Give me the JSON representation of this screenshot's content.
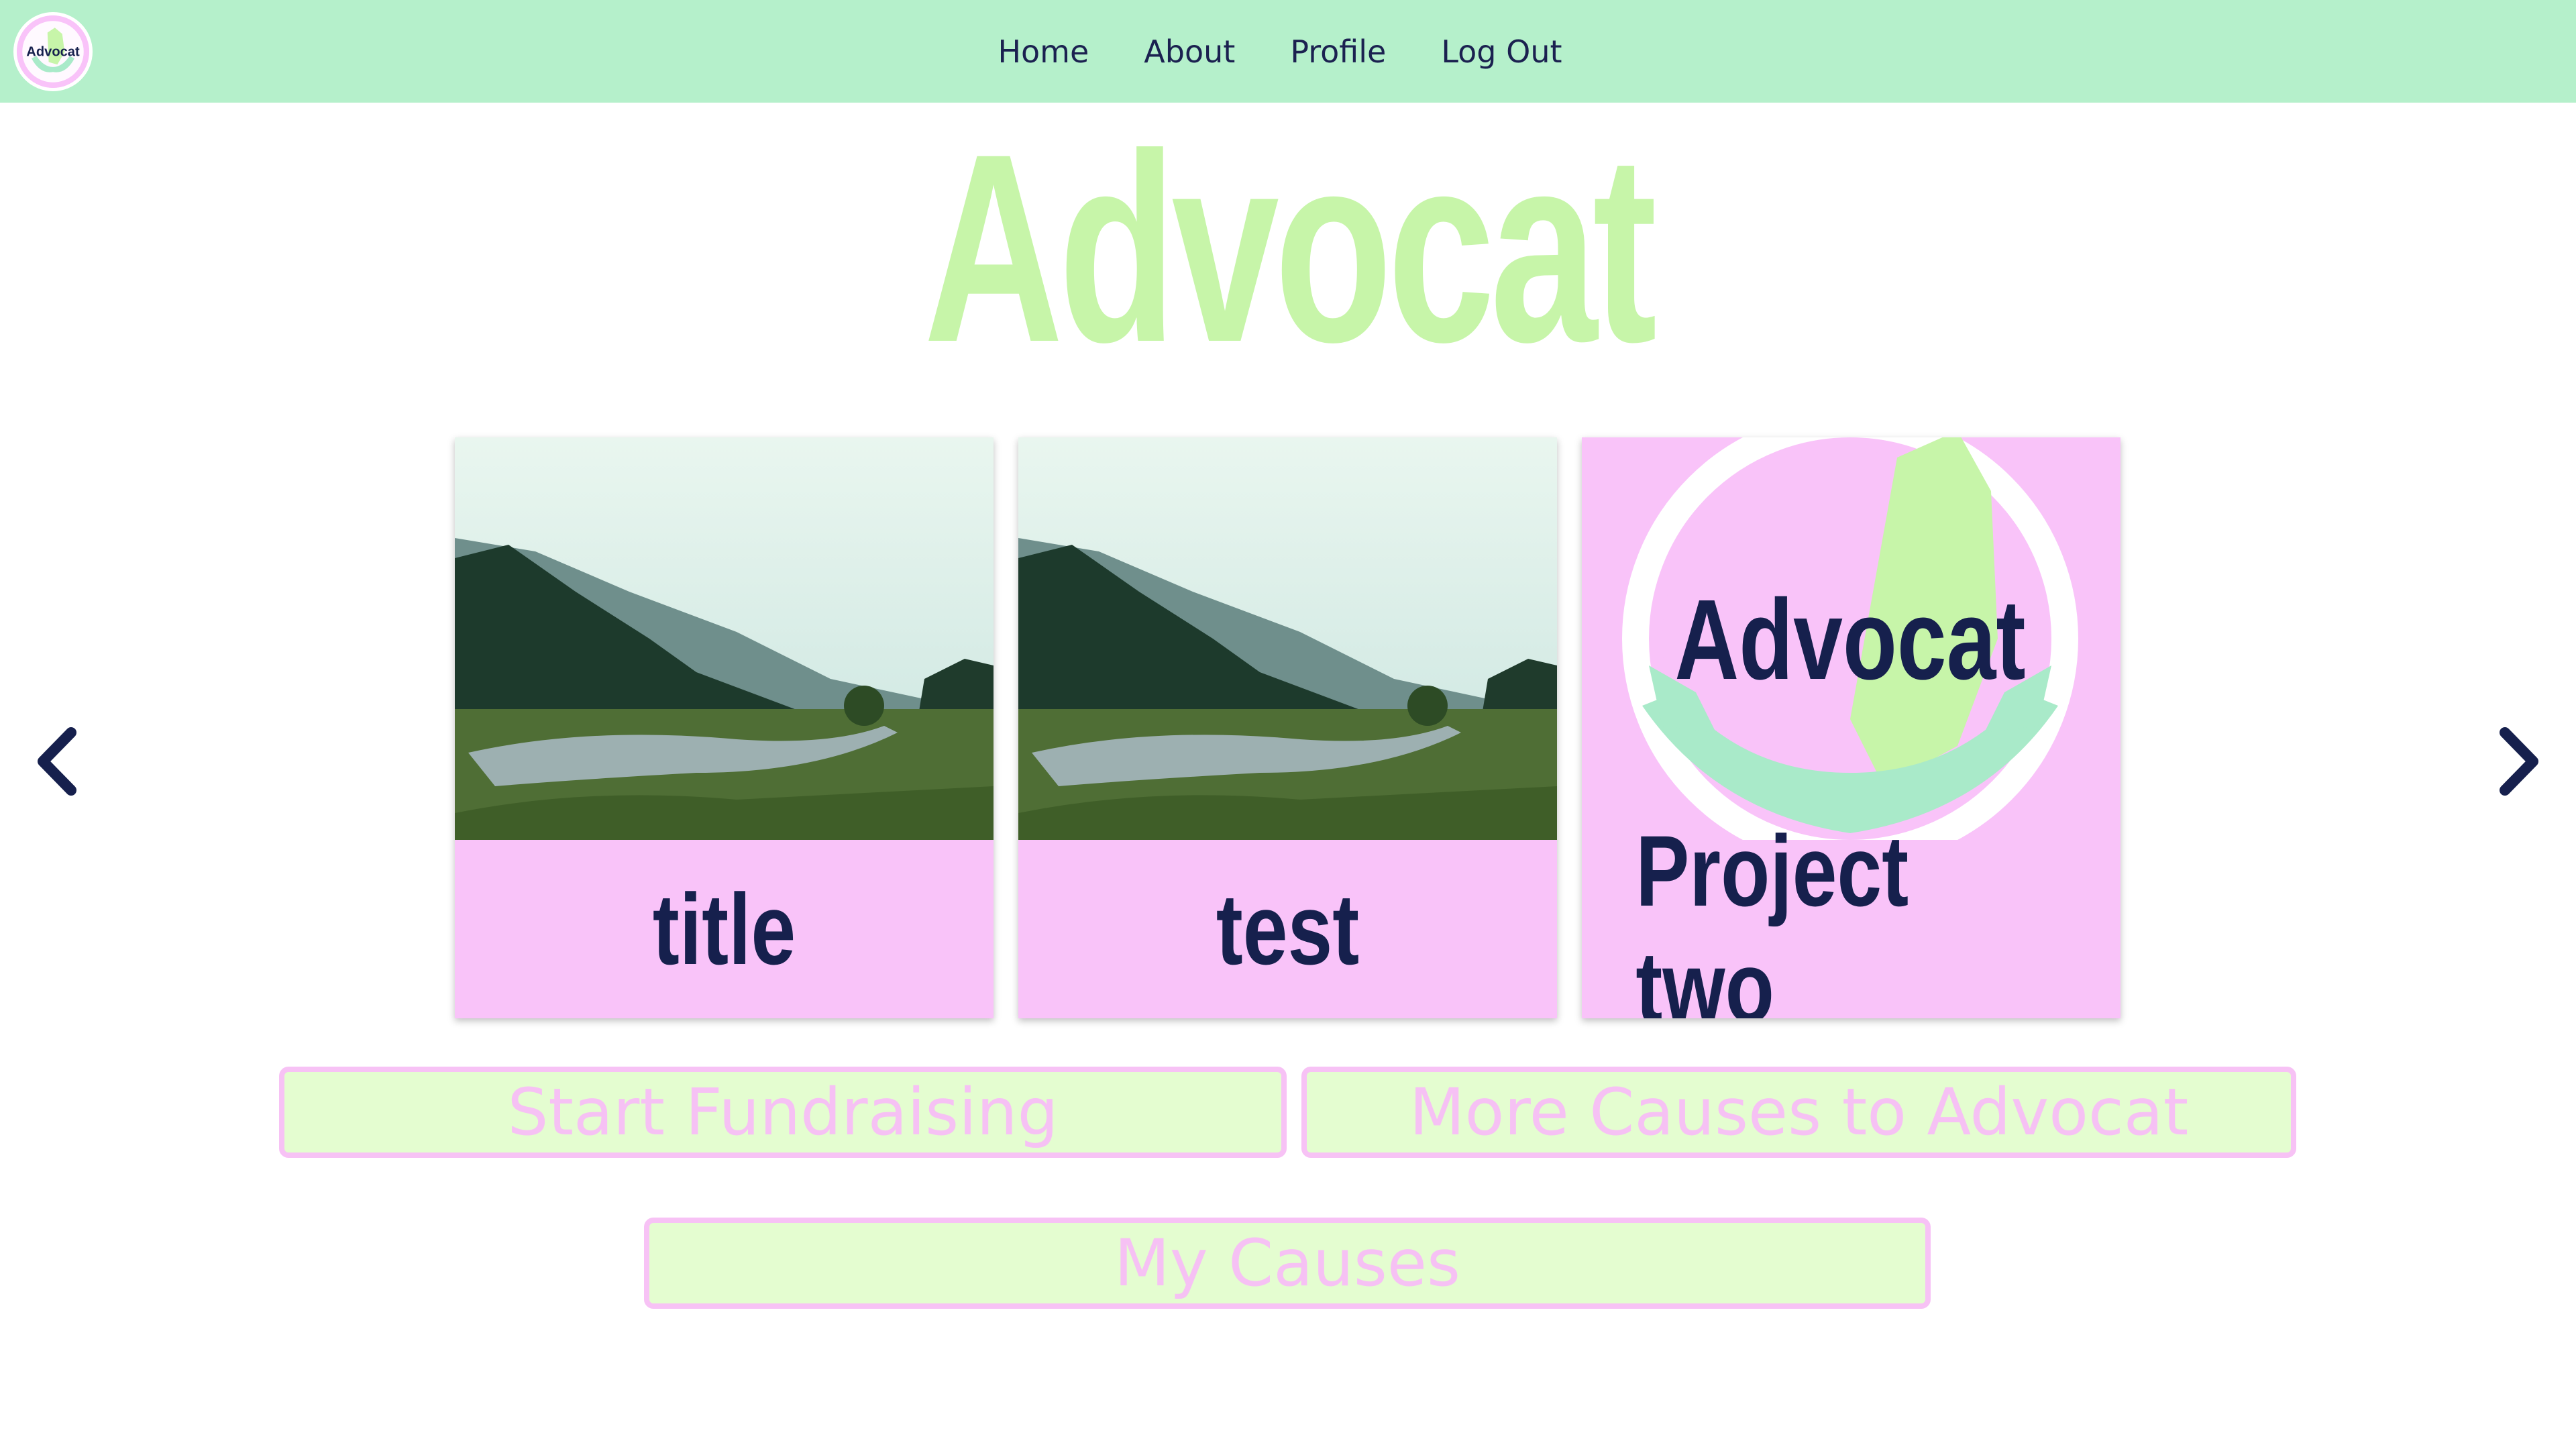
{
  "nav": {
    "logo_text": "Advocat",
    "links": [
      "Home",
      "About",
      "Profile",
      "Log Out"
    ]
  },
  "hero": {
    "title": "Advocat"
  },
  "carousel": {
    "prev_icon": "chevron-left-icon",
    "next_icon": "chevron-right-icon",
    "cards": [
      {
        "title": "title",
        "image": "landscape-photo"
      },
      {
        "title": "test",
        "image": "landscape-photo"
      },
      {
        "title": "Project two",
        "image": "advocat-logo",
        "logo_text": "Advocat"
      }
    ]
  },
  "actions": {
    "start_fundraising": "Start Fundraising",
    "more_causes": "More Causes to Advocat",
    "my_causes": "My Causes"
  },
  "colors": {
    "navbar": "#b5f0cb",
    "hero_title": "#c7f5a9",
    "card_bg": "#f9c3f9",
    "card_title": "#16204d",
    "button_bg": "#e4fdd0",
    "button_border": "#f7c2f5",
    "arrow": "#16204d"
  }
}
